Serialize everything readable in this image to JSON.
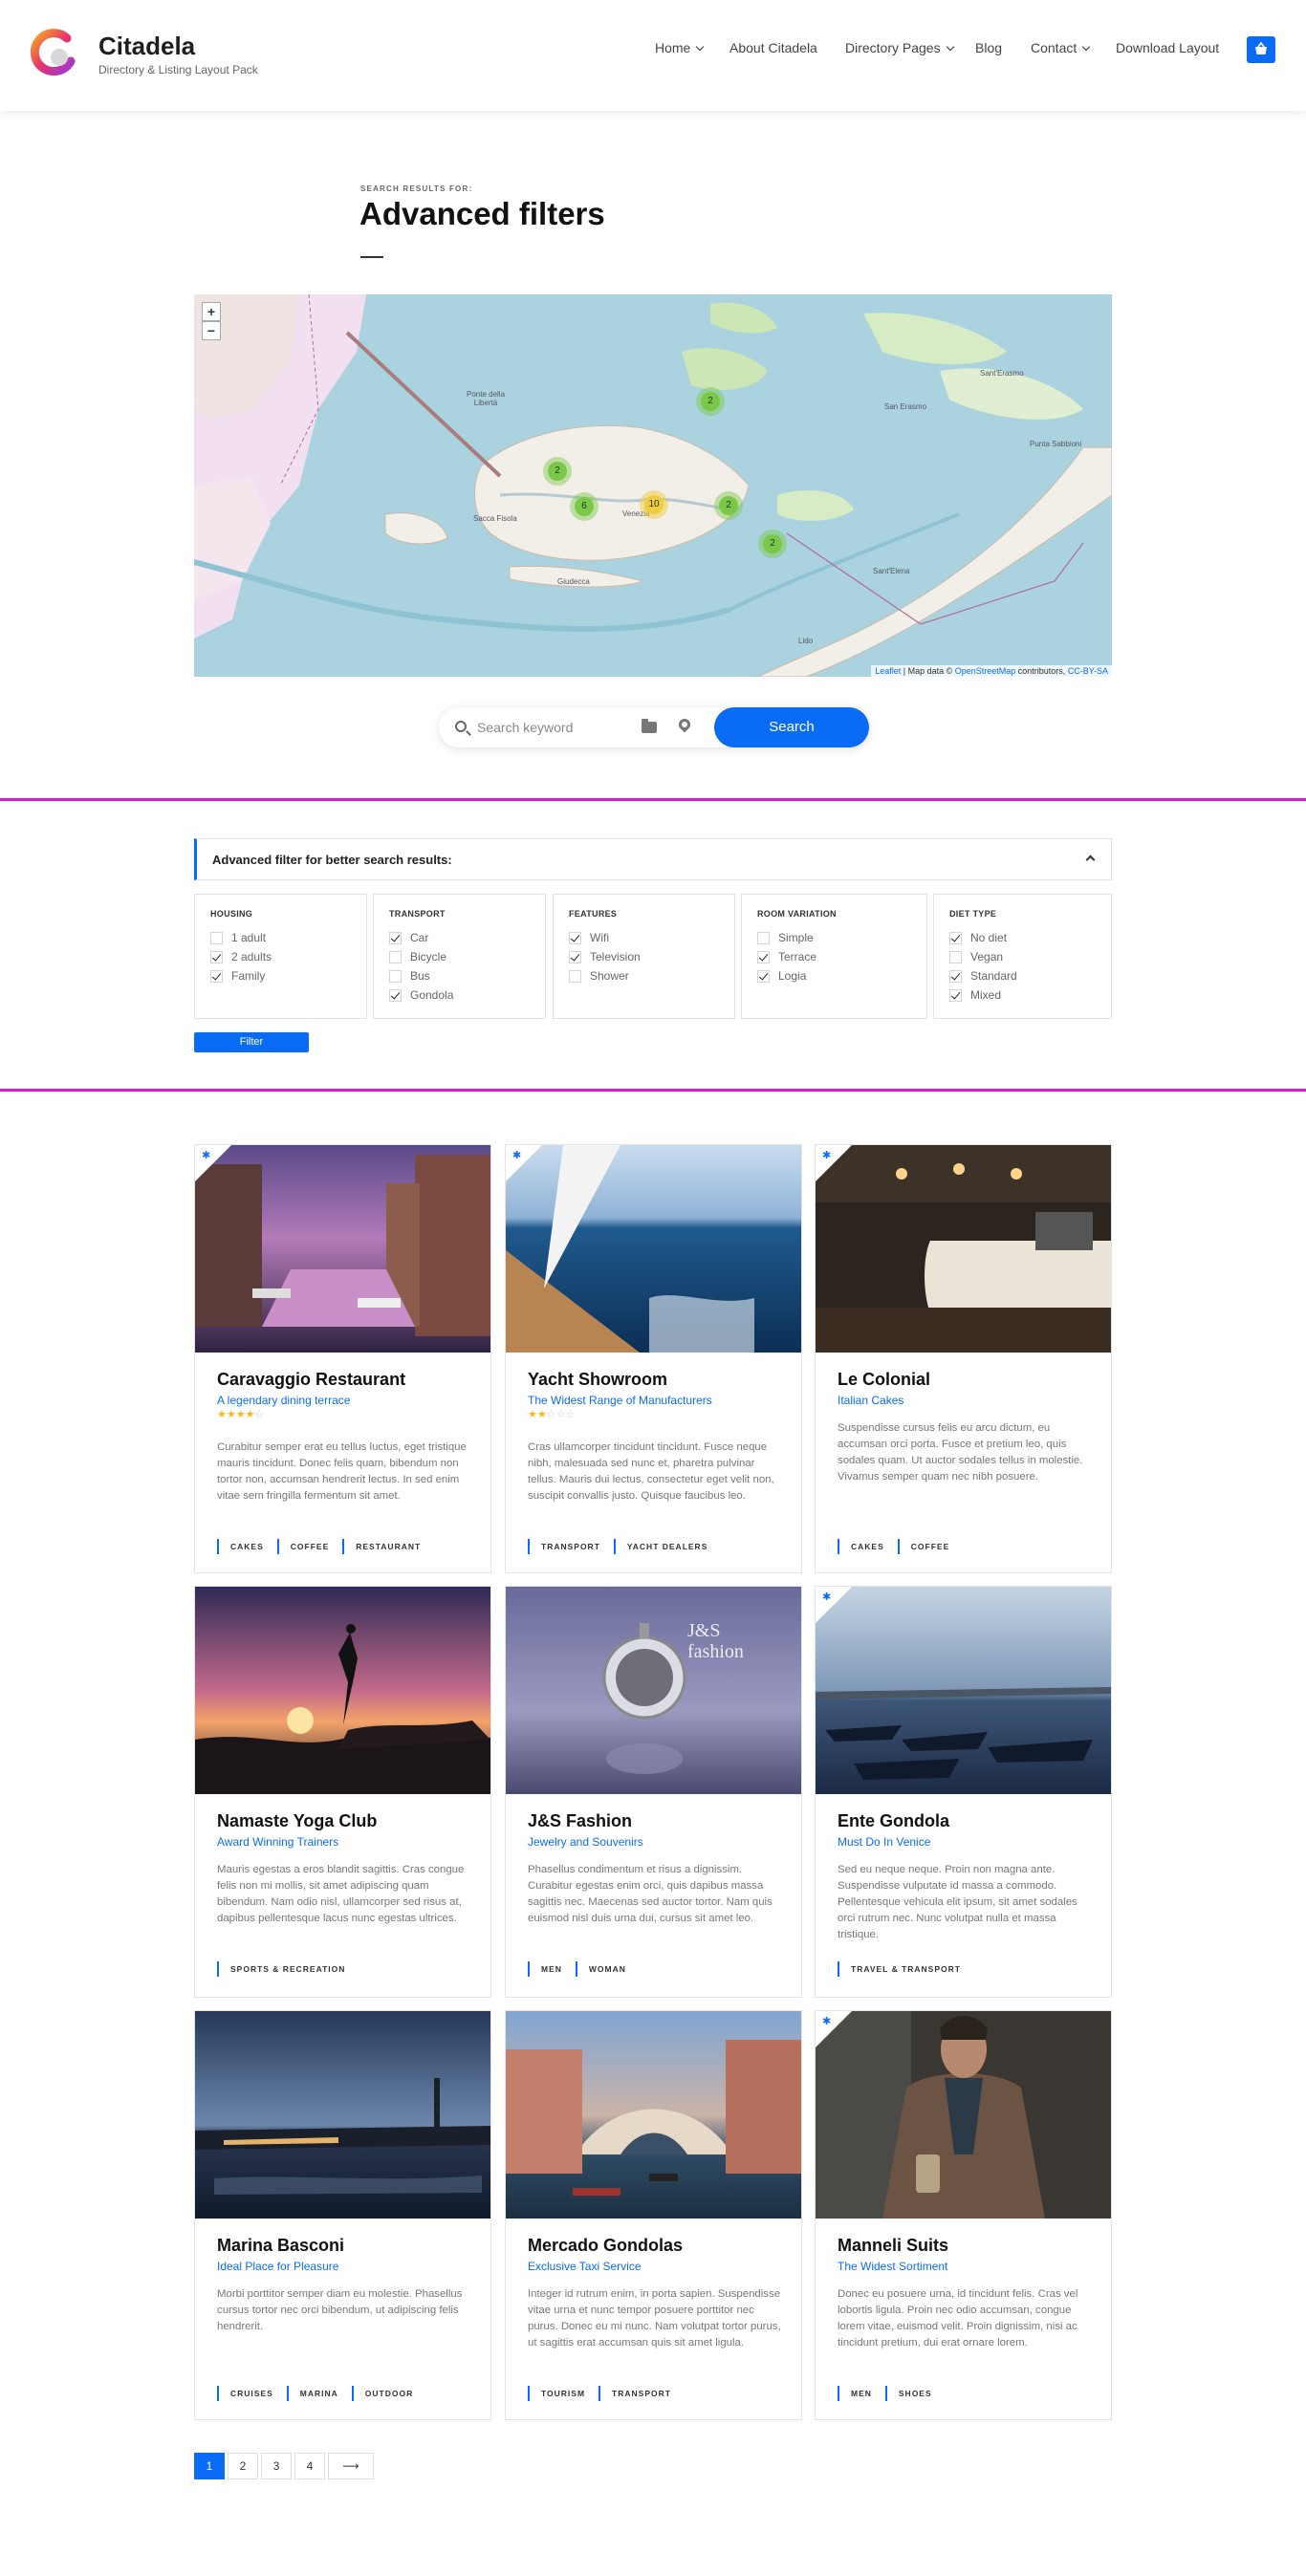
{
  "header": {
    "brand": "Citadela",
    "tagline": "Directory & Listing Layout Pack",
    "nav": [
      {
        "label": "Home",
        "dropdown": true
      },
      {
        "label": "About Citadela",
        "dropdown": false
      },
      {
        "label": "Directory Pages",
        "dropdown": true
      },
      {
        "label": "Blog",
        "dropdown": false
      },
      {
        "label": "Contact",
        "dropdown": true
      },
      {
        "label": "Download Layout",
        "dropdown": false
      }
    ],
    "cart_icon": "cart-icon"
  },
  "page": {
    "eyebrow": "SEARCH RESULTS FOR:",
    "title": "Advanced filters"
  },
  "map": {
    "zoom_in": "+",
    "zoom_out": "−",
    "clusters": [
      "2",
      "2",
      "6",
      "10",
      "2",
      "2"
    ],
    "labels": [
      "Ponte della Libertà",
      "Venezia",
      "Giudecca",
      "San Erasmo",
      "Sant'Erasmo",
      "Punta Sabbioni",
      "Lido",
      "Sant'Elena",
      "Sacca Fisola"
    ],
    "attribution": {
      "leaflet": "Leaflet",
      "middle": " | Map data © ",
      "osm": "OpenStreetMap",
      "after": " contributors, ",
      "license": "CC-BY-SA"
    }
  },
  "search": {
    "placeholder": "Search keyword",
    "button": "Search"
  },
  "filter": {
    "header": "Advanced filter for better search results:",
    "groups": [
      {
        "title": "HOUSING",
        "options": [
          {
            "label": "1 adult",
            "checked": false
          },
          {
            "label": "2 adults",
            "checked": true
          },
          {
            "label": "Family",
            "checked": true
          }
        ]
      },
      {
        "title": "TRANSPORT",
        "options": [
          {
            "label": "Car",
            "checked": true
          },
          {
            "label": "Bicycle",
            "checked": false
          },
          {
            "label": "Bus",
            "checked": false
          },
          {
            "label": "Gondola",
            "checked": true
          }
        ]
      },
      {
        "title": "FEATURES",
        "options": [
          {
            "label": "Wifi",
            "checked": true
          },
          {
            "label": "Television",
            "checked": true
          },
          {
            "label": "Shower",
            "checked": false
          }
        ]
      },
      {
        "title": "ROOM VARIATION",
        "options": [
          {
            "label": "Simple",
            "checked": false
          },
          {
            "label": "Terrace",
            "checked": true
          },
          {
            "label": "Logia",
            "checked": true
          }
        ]
      },
      {
        "title": "DIET TYPE",
        "options": [
          {
            "label": "No diet",
            "checked": true
          },
          {
            "label": "Vegan",
            "checked": false
          },
          {
            "label": "Standard",
            "checked": true
          },
          {
            "label": "Mixed",
            "checked": true
          }
        ]
      }
    ],
    "button": "Filter"
  },
  "listings": [
    {
      "title": "Caravaggio Restaurant",
      "subtitle": "A legendary dining terrace",
      "featured": true,
      "rating": 4,
      "text": "Curabitur semper erat eu tellus luctus, eget tristique mauris tincidunt. Donec felis quam, bibendum non tortor non, accumsan hendrerit lectus. In sed enim vitae sem fringilla fermentum sit amet.",
      "tags": [
        "CAKES",
        "COFFEE",
        "RESTAURANT"
      ],
      "image": "venice-canal-dusk-photo"
    },
    {
      "title": "Yacht Showroom",
      "subtitle": "The Widest Range of Manufacturers",
      "featured": true,
      "rating": 2,
      "text": "Cras ullamcorper tincidunt tincidunt. Fusce neque nibh, malesuada sed nunc et, pharetra pulvinar tellus. Mauris dui lectus, consectetur eget velit non, suscipit convallis justo. Quisque faucibus leo.",
      "tags": [
        "TRANSPORT",
        "YACHT DEALERS"
      ],
      "image": "yacht-at-sea-photo"
    },
    {
      "title": "Le Colonial",
      "subtitle": "Italian Cakes",
      "featured": true,
      "rating": 0,
      "text": "Suspendisse cursus felis eu arcu dictum, eu accumsan orci porta. Fusce et pretium leo, quis sodales quam. Ut auctor sodales tellus in molestie. Vivamus semper quam nec nibh posuere.",
      "tags": [
        "CAKES",
        "COFFEE"
      ],
      "image": "cafe-interior-photo"
    },
    {
      "title": "Namaste Yoga Club",
      "subtitle": "Award Winning Trainers",
      "featured": false,
      "rating": 0,
      "text": "Mauris egestas a eros blandit sagittis. Cras congue felis non mi mollis, sit amet adipiscing quam bibendum. Nam odio nisl, ullamcorper sed risus at, dapibus pellentesque lacus nunc egestas ultrices.",
      "tags": [
        "SPORTS & RECREATION"
      ],
      "image": "yoga-sunset-photo"
    },
    {
      "title": "J&S Fashion",
      "subtitle": "Jewelry and Souvenirs",
      "featured": false,
      "rating": 0,
      "text": "Phasellus condimentum et risus a dignissim. Curabitur egestas enim orci, quis dapibus massa sagittis nec. Maecenas sed auctor tortor. Nam quis euismod nisl duis urna dui, cursus sit amet leo.",
      "tags": [
        "MEN",
        "WOMAN"
      ],
      "image": "pocket-watch-photo",
      "image_text": "J&S fashion"
    },
    {
      "title": "Ente Gondola",
      "subtitle": "Must Do In Venice",
      "featured": true,
      "rating": 0,
      "text": "Sed eu neque neque. Proin non magna ante. Suspendisse vulputate id massa a commodo. Pellentesque vehicula elit ipsum, sit amet sodales orci rutrum nec. Nunc volutpat nulla et massa tristique.",
      "tags": [
        "TRAVEL & TRANSPORT"
      ],
      "image": "gondolas-photo"
    },
    {
      "title": "Marina Basconi",
      "subtitle": "Ideal Place for Pleasure",
      "featured": false,
      "rating": 0,
      "text": "Morbi porttitor semper diam eu molestie. Phasellus cursus tortor nec orci bibendum, ut adipiscing felis hendrerit.",
      "tags": [
        "CRUISES",
        "MARINA",
        "OUTDOOR"
      ],
      "image": "venice-night-photo"
    },
    {
      "title": "Mercado Gondolas",
      "subtitle": "Exclusive Taxi Service",
      "featured": false,
      "rating": 0,
      "text": "Integer id rutrum enim, in porta sapien. Suspendisse vitae urna et nunc tempor posuere porttitor nec purus. Donec eu mi nunc. Nam volutpat tortor purus, ut sagittis erat accumsan quis sit amet ligula.",
      "tags": [
        "TOURISM",
        "TRANSPORT"
      ],
      "image": "rialto-bridge-photo"
    },
    {
      "title": "Manneli Suits",
      "subtitle": "The Widest Sortiment",
      "featured": true,
      "rating": 0,
      "text": "Donec eu posuere urna, id tincidunt felis. Cras vel lobortis ligula. Proin nec odio accumsan, congue lorem vitae, euismod velit. Proin dignissim, nisi ac tincidunt pretium, dui erat ornare lorem.",
      "tags": [
        "MEN",
        "SHOES"
      ],
      "image": "man-in-coat-photo"
    }
  ],
  "pagination": {
    "pages": [
      "1",
      "2",
      "3",
      "4"
    ],
    "active": "1",
    "next": "⟶"
  }
}
